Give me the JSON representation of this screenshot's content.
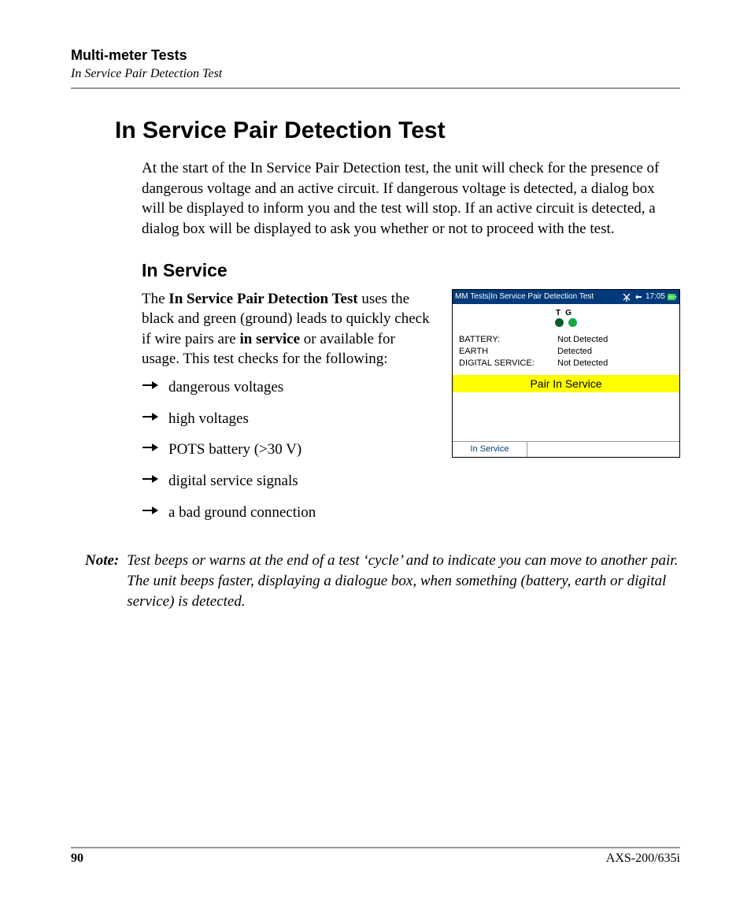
{
  "header": {
    "chapter": "Multi-meter Tests",
    "section": "In Service Pair Detection Test"
  },
  "title": "In Service Pair Detection Test",
  "intro": "At the start of the In Service Pair Detection test, the unit will check for the presence of dangerous voltage and an active circuit. If dangerous voltage is detected, a dialog box will be displayed to inform you and the test will stop. If an active circuit is detected, a dialog box will be displayed to ask you whether or not to proceed with the test.",
  "subtitle": "In Service",
  "para": {
    "lead": "The ",
    "bold1": "In Service Pair Detection Test",
    "mid1": " uses the black and green (ground) leads to quickly check if wire pairs are ",
    "bold2": "in service",
    "mid2": " or available for usage. This test checks for the following:"
  },
  "bullets": [
    "dangerous voltages",
    "high voltages",
    "POTS battery (>30 V)",
    "digital service signals",
    "a bad ground connection"
  ],
  "device": {
    "title": "MM Tests|In Service Pair Detection Test",
    "time": "17:05",
    "tg_t": "T",
    "tg_g": "G",
    "rows": [
      {
        "k": "BATTERY:",
        "v": "Not Detected"
      },
      {
        "k": "EARTH",
        "v": "Detected"
      },
      {
        "k": "DIGITAL SERVICE:",
        "v": "Not Detected"
      }
    ],
    "banner": "Pair In Service",
    "footer_tab": "In Service"
  },
  "note": {
    "label": "Note:",
    "body": "Test beeps or warns at the end of a test ‘cycle’ and to indicate you can move to another pair. The unit beeps faster, displaying a dialogue box, when something (battery, earth or digital service) is detected."
  },
  "footer": {
    "page": "90",
    "model": "AXS-200/635i"
  }
}
